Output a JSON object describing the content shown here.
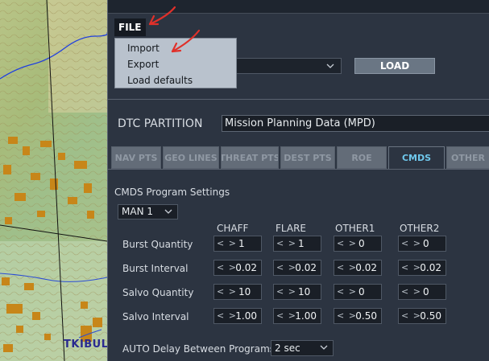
{
  "map": {
    "place_label": "TKIBUL"
  },
  "file_menu": {
    "label": "FILE",
    "items": [
      "Import",
      "Export",
      "Load defaults"
    ]
  },
  "preset": {
    "value": ""
  },
  "load_label": "LOAD",
  "partition": {
    "label": "DTC PARTITION",
    "value": "Mission Planning Data (MPD)"
  },
  "tabs": [
    {
      "label": "NAV PTS",
      "active": false
    },
    {
      "label": "GEO LINES",
      "active": false
    },
    {
      "label": "THREAT PTS",
      "active": false
    },
    {
      "label": "DEST PTS",
      "active": false
    },
    {
      "label": "ROE",
      "active": false
    },
    {
      "label": "CMDS",
      "active": true
    },
    {
      "label": "OTHER",
      "active": false
    }
  ],
  "cmds": {
    "section_title": "CMDS Program Settings",
    "program": "MAN 1",
    "columns": [
      "CHAFF",
      "FLARE",
      "OTHER1",
      "OTHER2"
    ],
    "rows": [
      {
        "label": "Burst Quantity",
        "values": [
          "1",
          "1",
          "0",
          "0"
        ]
      },
      {
        "label": "Burst Interval",
        "values": [
          "0.02",
          "0.02",
          "0.02",
          "0.02"
        ]
      },
      {
        "label": "Salvo Quantity",
        "values": [
          "10",
          "10",
          "0",
          "0"
        ]
      },
      {
        "label": "Salvo Interval",
        "values": [
          "1.00",
          "1.00",
          "0.50",
          "0.50"
        ]
      }
    ],
    "auto_delay_label": "AUTO Delay Between Programs",
    "auto_delay_value": "2 sec"
  },
  "colors": {
    "active_tab": "#6fc8ec",
    "annotation": "#e0302a",
    "menu_bg": "#b9c2cd"
  }
}
